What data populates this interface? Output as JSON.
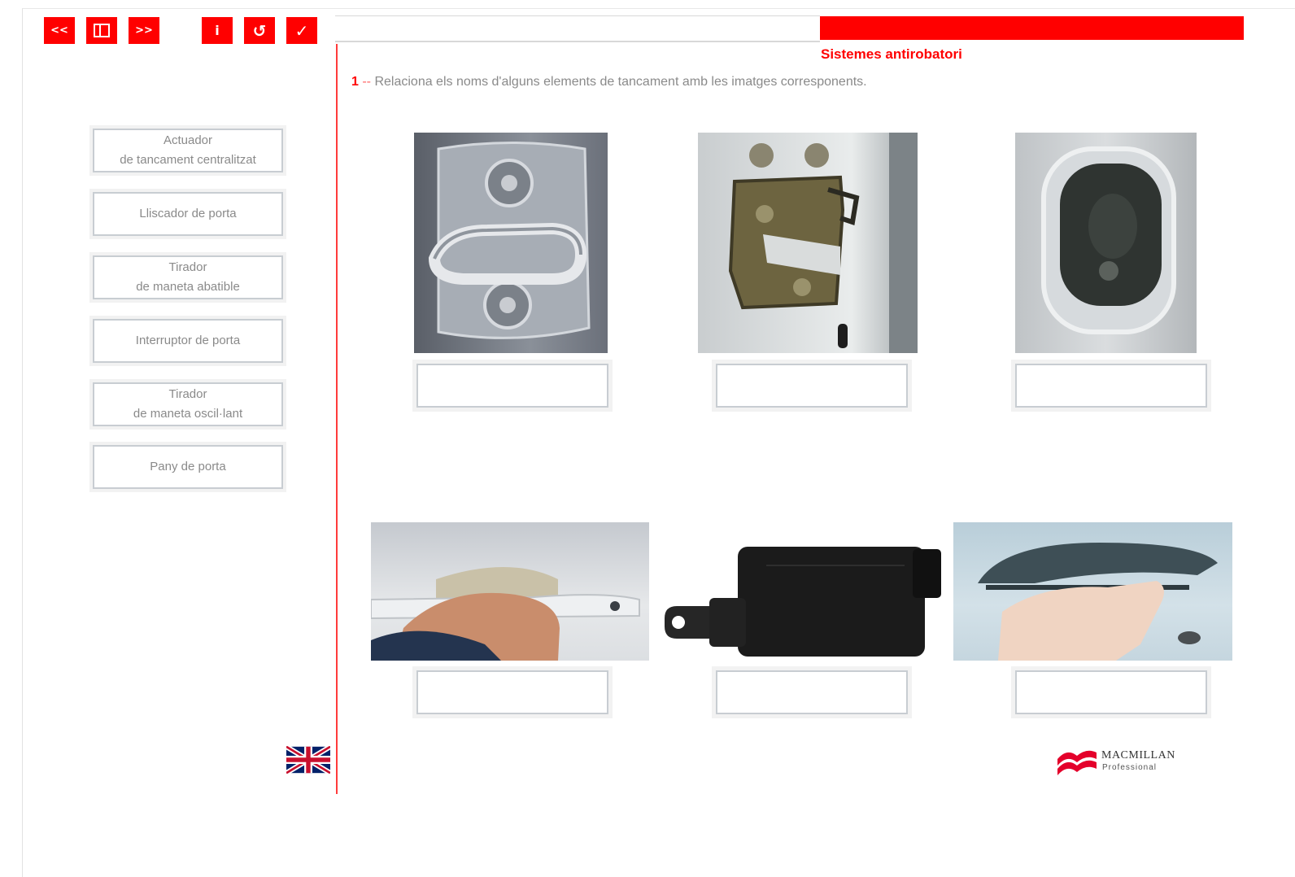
{
  "toolbar": {
    "first_label": "<<",
    "index_label": "▤",
    "next_label": ">>",
    "info_label": "i",
    "reset_label": "↺",
    "check_label": "✓",
    "icons": [
      "first-icon",
      "index-icon",
      "next-icon",
      "info-icon",
      "reset-icon",
      "check-icon"
    ]
  },
  "header": {
    "section_title": "Sistemes antirobatori",
    "accent_color": "#ff0000"
  },
  "exercise": {
    "number": "1",
    "separator": " -- ",
    "instruction": "Relaciona els noms d'alguns elements de tancament amb les imatges corresponents."
  },
  "labels": [
    {
      "line1": "Actuador",
      "line2": "de tancament centralitzat"
    },
    {
      "line1": "Lliscador de porta",
      "line2": ""
    },
    {
      "line1": "Tirador",
      "line2": "de maneta abatible"
    },
    {
      "line1": "Interruptor de porta",
      "line2": ""
    },
    {
      "line1": "Tirador",
      "line2": "de maneta oscil·lant"
    },
    {
      "line1": "Pany de porta",
      "line2": ""
    }
  ],
  "drop_targets": [
    {
      "value": ""
    },
    {
      "value": ""
    },
    {
      "value": ""
    },
    {
      "value": ""
    },
    {
      "value": ""
    },
    {
      "value": ""
    }
  ],
  "footer": {
    "language_flag": "uk-flag-icon",
    "publisher_name": "MACMILLAN",
    "publisher_sub": "Professional"
  }
}
